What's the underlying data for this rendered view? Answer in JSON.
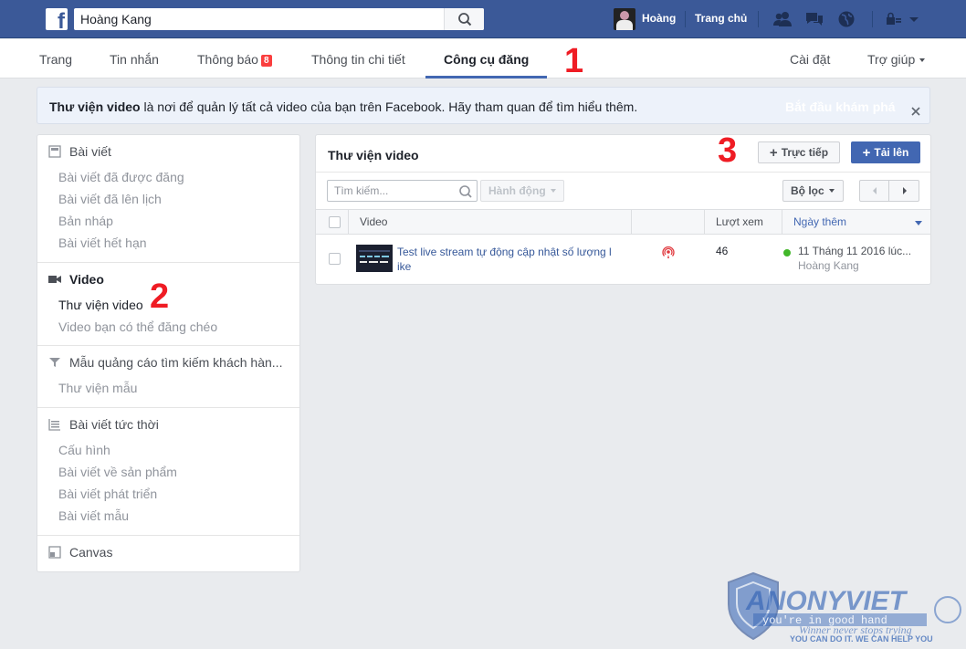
{
  "topbar": {
    "search_value": "Hoàng Kang",
    "user_name": "Hoàng",
    "home_label": "Trang chủ",
    "icons": [
      "friend-requests-icon",
      "messages-icon",
      "notifications-globe-icon",
      "privacy-shortcuts-icon",
      "account-menu-icon"
    ]
  },
  "nav": {
    "items": [
      {
        "label": "Trang"
      },
      {
        "label": "Tin nhắn"
      },
      {
        "label": "Thông báo",
        "badge": "8"
      },
      {
        "label": "Thông tin chi tiết"
      },
      {
        "label": "Công cụ đăng",
        "active": true
      }
    ],
    "settings": "Cài đặt",
    "help": "Trợ giúp"
  },
  "annotations": {
    "one": "1",
    "two": "2",
    "three": "3"
  },
  "banner": {
    "title": "Thư viện video",
    "text": " là nơi để quản lý tất cả video của bạn trên Facebook. Hãy tham quan để tìm hiểu thêm.",
    "link": "Bắt đầu khám phá"
  },
  "sidebar": {
    "posts": {
      "heading": "Bài viết",
      "items": [
        "Bài viết đã được đăng",
        "Bài viết đã lên lịch",
        "Bản nháp",
        "Bài viết hết hạn"
      ]
    },
    "video": {
      "heading": "Video",
      "items": [
        "Thư viện video",
        "Video bạn có thể đăng chéo"
      ]
    },
    "lead_ads": {
      "heading": "Mẫu quảng cáo tìm kiếm khách hàn...",
      "items": [
        "Thư viện mẫu"
      ]
    },
    "instant": {
      "heading": "Bài viết tức thời",
      "items": [
        "Cấu hình",
        "Bài viết về sản phẩm",
        "Bài viết phát triển",
        "Bài viết mẫu"
      ]
    },
    "canvas": {
      "heading": "Canvas"
    }
  },
  "panel": {
    "title": "Thư viện video",
    "live_button": "Trực tiếp",
    "upload_button": "Tải lên",
    "search_placeholder": "Tìm kiếm...",
    "action_button": "Hành động",
    "filter_button": "Bộ lọc",
    "columns": {
      "video": "Video",
      "views": "Lượt xem",
      "date_added": "Ngày thêm"
    },
    "rows": [
      {
        "title": "Test live stream tự động cập nhật số lượng like",
        "views": "46",
        "date": "11 Tháng 11 2016 lúc...",
        "author": "Hoàng Kang"
      }
    ]
  },
  "colors": {
    "brand_blue": "#3b5998",
    "primary_button": "#4267b2",
    "annotation_red": "#ef1c24",
    "badge_red": "#fa3e3e",
    "status_green": "#42b72a"
  },
  "watermark": {
    "brand": "ANONYVIET",
    "tagline1": "you're in good hand",
    "tagline2": "Winner never stops trying",
    "tagline3": "YOU CAN DO IT. WE CAN HELP YOU"
  }
}
